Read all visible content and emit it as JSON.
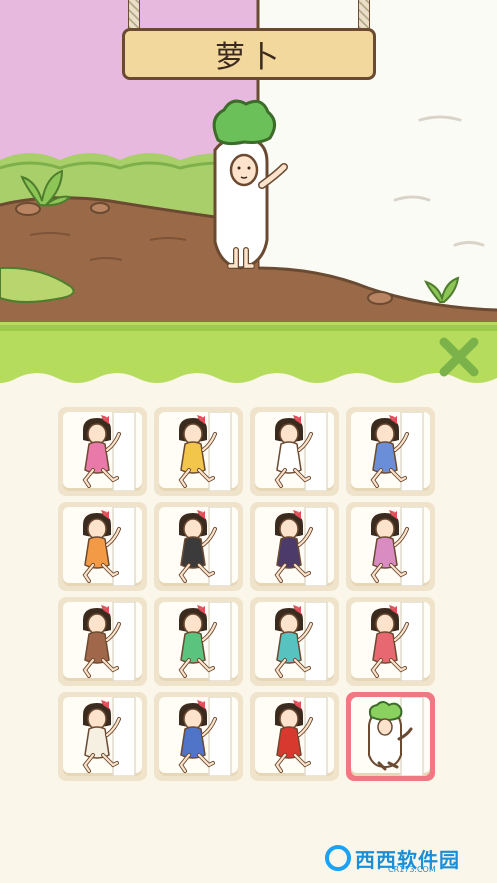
{
  "scene": {
    "sign_title": "萝卜"
  },
  "panel": {
    "close_icon": "x-icon",
    "accent_color": "#b6dc5e",
    "close_color": "#7bb34a"
  },
  "costumes": [
    {
      "id": "girl-pink-dress",
      "color": "#e879a8"
    },
    {
      "id": "girl-yellow-backpack",
      "color": "#f2c64a"
    },
    {
      "id": "girl-white-shirt",
      "color": "#ffffff"
    },
    {
      "id": "girl-blue-dots-bag",
      "color": "#6a8fd8"
    },
    {
      "id": "girl-orange-basket",
      "color": "#f39a46"
    },
    {
      "id": "girl-glasses-black",
      "color": "#3b3b3b"
    },
    {
      "id": "girl-ninja-purple",
      "color": "#4b3a6a"
    },
    {
      "id": "girl-pineapple-basket",
      "color": "#d98cc2"
    },
    {
      "id": "monkey-suit",
      "color": "#a0674a"
    },
    {
      "id": "girl-red-beret",
      "color": "#5ac47e"
    },
    {
      "id": "girl-teal-dress",
      "color": "#58c2c1"
    },
    {
      "id": "girl-red-dress",
      "color": "#e86872"
    },
    {
      "id": "girl-straw-hat",
      "color": "#f6f0e2"
    },
    {
      "id": "girl-blue-leaf-fan",
      "color": "#4f74c8"
    },
    {
      "id": "girl-red-qipao",
      "color": "#d8392e"
    },
    {
      "id": "radish-costume",
      "color": "#ffffff"
    }
  ],
  "selected_index": 15,
  "watermark": {
    "brand": "西西软件园",
    "site": "CR173.COM"
  }
}
